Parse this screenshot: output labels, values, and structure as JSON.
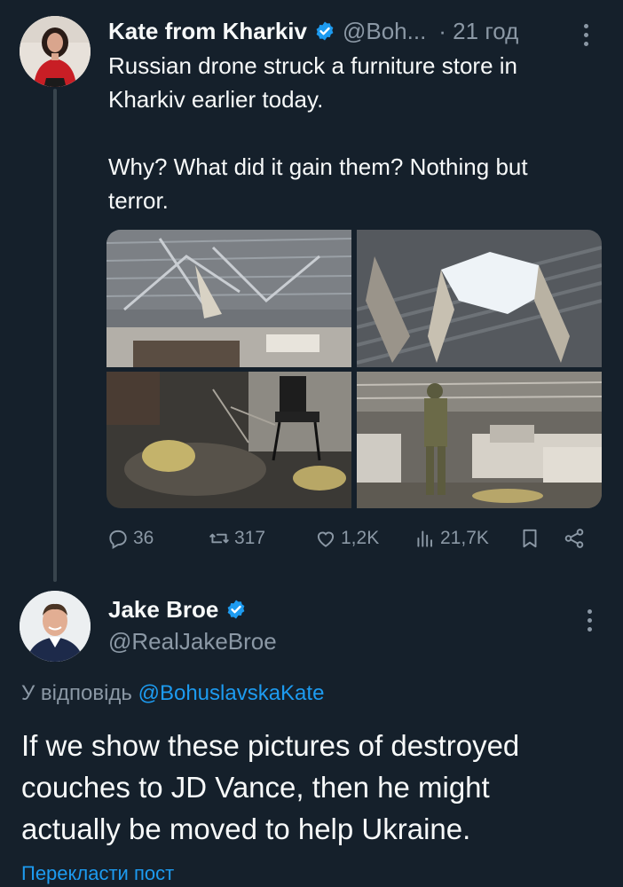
{
  "colors": {
    "background": "#15202b",
    "text": "#f7f9f9",
    "secondary": "#8b98a5",
    "accent": "#1d9bf0",
    "thread_line": "#38444d"
  },
  "tweet": {
    "author_name": "Kate from Kharkiv",
    "author_handle": "@Boh...",
    "time": "· 21 год",
    "text_line_1": "Russian drone struck a furniture store in",
    "text_line_2": "Kharkiv earlier today.",
    "text_line_3": "Why? What did it gain them? Nothing but",
    "text_line_4": "terror.",
    "media_count": 4,
    "actions": {
      "replies": "36",
      "reposts": "317",
      "likes": "1,2K",
      "views": "21,7K"
    },
    "icons": [
      "reply-icon",
      "repost-icon",
      "like-icon",
      "views-icon",
      "bookmark-icon",
      "share-icon",
      "more-icon",
      "verified-icon"
    ]
  },
  "reply": {
    "author_name": "Jake Broe",
    "author_handle": "@RealJakeBroe",
    "reply_prefix": "У відповідь",
    "reply_mention": "@BohuslavskaKate",
    "text_line_1": "If we show these pictures of destroyed",
    "text_line_2": "couches to JD Vance, then he might",
    "text_line_3": "actually be moved to help Ukraine.",
    "translate_label": "Перекласти пост"
  }
}
